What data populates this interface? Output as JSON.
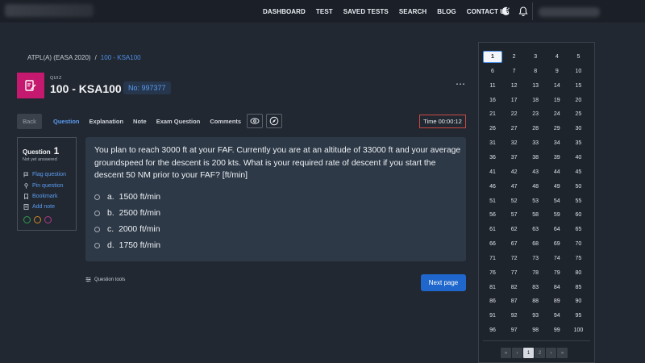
{
  "nav": {
    "links": [
      "DASHBOARD",
      "TEST",
      "SAVED TESTS",
      "SEARCH",
      "BLOG",
      "CONTACT US"
    ]
  },
  "breadcrumb": {
    "root": "ATPL(A) (EASA 2020)",
    "separator": "/",
    "current": "100 - KSA100"
  },
  "quiz": {
    "label": "QUIZ",
    "title": "100 - KSA100",
    "number": "No: 997377"
  },
  "tabs": {
    "back": "Back",
    "items": [
      "Question",
      "Explanation",
      "Note",
      "Exam Question",
      "Comments"
    ],
    "active": "Question"
  },
  "timer": "Time 00:00:12",
  "question_panel": {
    "title": "Question",
    "number": "1",
    "status": "Not yet answered",
    "actions": [
      "Flag question",
      "Pin question",
      "Bookmark",
      "Add note"
    ],
    "tag_colors": [
      "#2e9e4f",
      "#d08a22",
      "#b03a8e"
    ]
  },
  "question": {
    "text": "You plan to reach 3000 ft at your FAF. Currently you are at an altitude of 33000 ft and your average groundspeed for the descent is 200 kts. What is your required rate of descent if you start the descent 50 NM prior to your FAF? [ft/min]",
    "answers": [
      {
        "letter": "a.",
        "text": "1500 ft/min"
      },
      {
        "letter": "b.",
        "text": "2500 ft/min"
      },
      {
        "letter": "c.",
        "text": "2000 ft/min"
      },
      {
        "letter": "d.",
        "text": "1750 ft/min"
      }
    ]
  },
  "footer": {
    "tools": "Question tools",
    "next": "Next page"
  },
  "grid": {
    "current": 1,
    "first": 1,
    "last": 100
  },
  "pager": {
    "prev_all": "«",
    "prev": "‹",
    "pages": [
      "1",
      "2"
    ],
    "active": "1",
    "next": "›",
    "next_all": "»"
  },
  "colors": {
    "accent": "#4c8fe6",
    "quiz_icon": "#c4196f",
    "timer_border": "#c94a45",
    "next_button": "#1f67cc"
  }
}
